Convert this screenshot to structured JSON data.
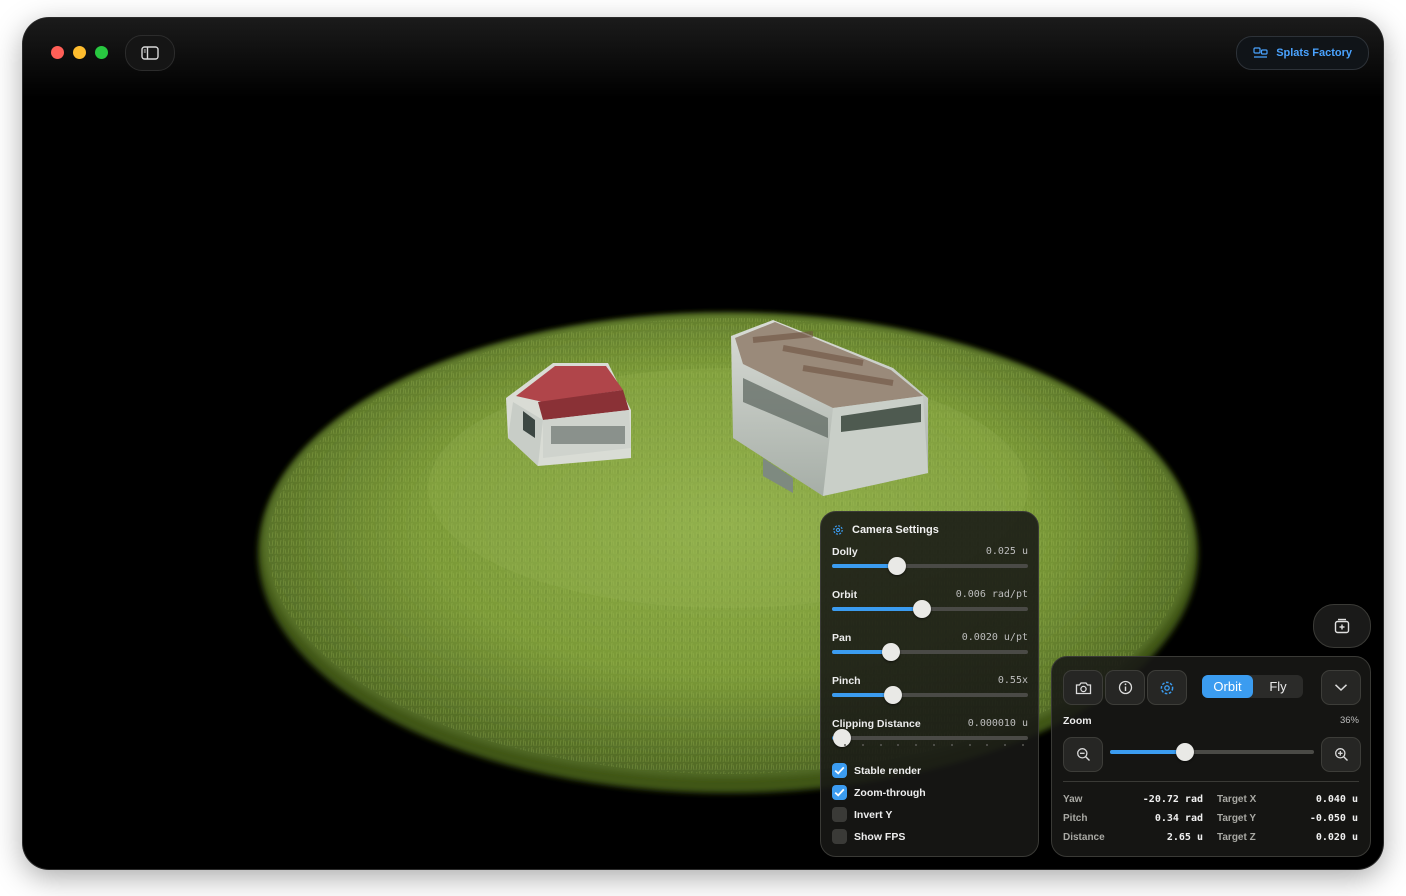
{
  "window": {
    "traffic_lights": [
      {
        "name": "close",
        "color": "#ff5f57"
      },
      {
        "name": "minimize",
        "color": "#febc2e"
      },
      {
        "name": "zoom",
        "color": "#28c840"
      }
    ],
    "sidebar_toggle_icon": "sidebar-icon",
    "app_badge": {
      "label": "Splats Factory",
      "icon": "splat-app-icon",
      "color": "#4aa3ff"
    }
  },
  "viewport": {
    "content": "3D gaussian splat scene: circular grass patch with an old red pickup truck and a rusted white bus/trailer"
  },
  "camera_settings": {
    "title": "Camera Settings",
    "icon": "gear-icon",
    "sliders": [
      {
        "label": "Dolly",
        "value": "0.025 u",
        "level": 0.33
      },
      {
        "label": "Orbit",
        "value": "0.006 rad/pt",
        "level": 0.46
      },
      {
        "label": "Pan",
        "value": "0.0020 u/pt",
        "level": 0.3
      },
      {
        "label": "Pinch",
        "value": "0.55x",
        "level": 0.31
      },
      {
        "label": "Clipping Distance",
        "value": "0.000010 u",
        "level": 0.05
      }
    ],
    "checkboxes": [
      {
        "label": "Stable render",
        "checked": true
      },
      {
        "label": "Zoom-through",
        "checked": true
      },
      {
        "label": "Invert Y",
        "checked": false
      },
      {
        "label": "Show FPS",
        "checked": false
      }
    ]
  },
  "controls": {
    "buttons": [
      "camera-icon",
      "info-icon",
      "gear-icon"
    ],
    "mode": {
      "options": [
        "Orbit",
        "Fly"
      ],
      "selected": "Orbit"
    },
    "expand_icon": "chevron-down-icon",
    "zoom": {
      "label": "Zoom",
      "percent": "36%",
      "level": 0.37
    },
    "zoom_out_icon": "zoom-out-icon",
    "zoom_in_icon": "zoom-in-icon",
    "stats_left": [
      {
        "key": "Yaw",
        "value": "-20.72 rad"
      },
      {
        "key": "Pitch",
        "value": "0.34 rad"
      },
      {
        "key": "Distance",
        "value": "2.65 u"
      }
    ],
    "stats_right": [
      {
        "key": "Target X",
        "value": "0.040 u"
      },
      {
        "key": "Target Y",
        "value": "-0.050 u"
      },
      {
        "key": "Target Z",
        "value": "0.020 u"
      }
    ]
  },
  "add_button_icon": "add-splat-icon",
  "colors": {
    "accent": "#3b9cf0",
    "background": "#000000",
    "grass": "#7d9a3a"
  }
}
